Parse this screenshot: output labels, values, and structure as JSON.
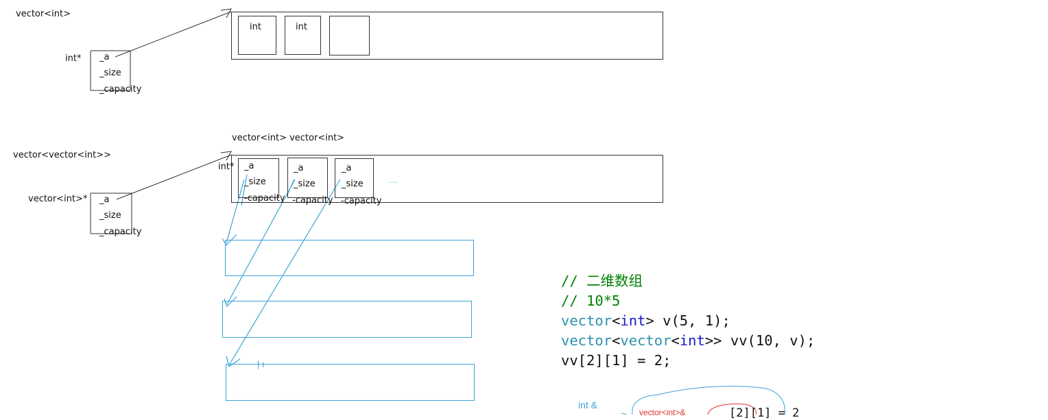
{
  "diagram1": {
    "title": "vector<int>",
    "ptr_type": "int*",
    "fields": [
      "_a",
      "_size",
      "_capacity"
    ],
    "cells": [
      "int",
      "int",
      ""
    ]
  },
  "diagram2": {
    "title": "vector<vector<int>>",
    "caption": "vector<int> vector<int>",
    "ptr_type": "vector<int>*",
    "inner_ptr_type": "int*",
    "fields": [
      "_a",
      "_size",
      "_capacity"
    ],
    "inner_fields": [
      [
        "_a",
        "_size",
        "-capacity"
      ],
      [
        "_a",
        "_size",
        "-capacity"
      ],
      [
        "_a",
        "_size",
        "-capacity"
      ]
    ],
    "ellipsis": "....",
    "row_marks": "|     ı"
  },
  "code": {
    "comment1": "// 二维数组",
    "comment2": "// 10*5",
    "line3_type": "vector",
    "line3_lt": "<",
    "line3_kw": "int",
    "line3_rest": "> v(5, 1);",
    "line4_type1": "vector",
    "line4_lt1": "<",
    "line4_type2": "vector",
    "line4_lt2": "<",
    "line4_kw": "int",
    "line4_rest": ">> vv(10, v);",
    "line5": "vv[2][1] = 2;"
  },
  "annotation": {
    "ref_type": "int &",
    "inner_ref": "vector<int>&",
    "partial": "[2][1]   = 2"
  },
  "colors": {
    "ink": "#333333",
    "hand_blue": "#3aa3d6",
    "hand_red": "#e03030",
    "code_type": "#2b91af",
    "code_keyword": "#1a1acc",
    "code_comment": "#008000"
  }
}
